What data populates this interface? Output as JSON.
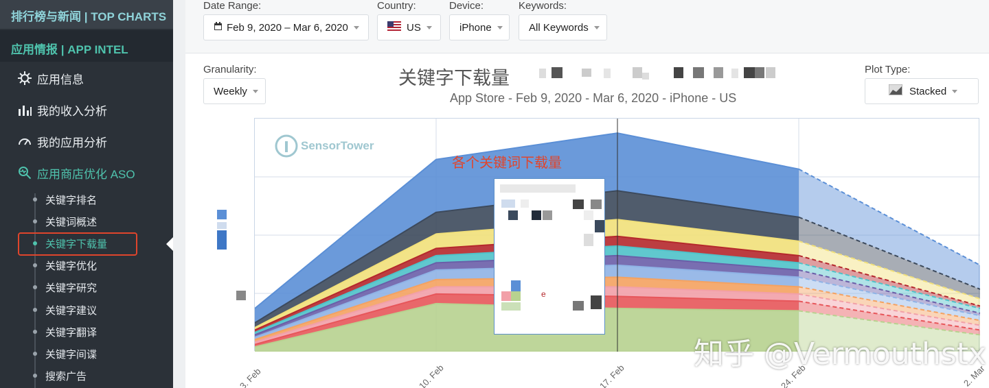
{
  "sidebar": {
    "top_label": "排行榜与新闻 | TOP CHARTS",
    "intel_label": "应用情报 | APP INTEL",
    "items": [
      {
        "label": "应用信息",
        "icon": "app-info-icon"
      },
      {
        "label": "我的收入分析",
        "icon": "revenue-chart-icon"
      },
      {
        "label": "我的应用分析",
        "icon": "gauge-icon"
      },
      {
        "label": "应用商店优化 ASO",
        "icon": "aso-search-icon"
      }
    ],
    "subitems": [
      "关键字排名",
      "关键词概述",
      "关键字下载量",
      "关键字优化",
      "关键字研究",
      "关键字建议",
      "关键字翻译",
      "关键字间谍",
      "搜索广告"
    ]
  },
  "filters": {
    "date_range_label": "Date Range:",
    "date_range_value": "Feb 9, 2020 – Mar 6, 2020",
    "country_label": "Country:",
    "country_value": "US",
    "device_label": "Device:",
    "device_value": "iPhone",
    "keywords_label": "Keywords:",
    "keywords_value": "All Keywords",
    "granularity_label": "Granularity:",
    "granularity_value": "Weekly",
    "plot_type_label": "Plot Type:",
    "plot_type_value": "Stacked"
  },
  "chart_header": {
    "title": "关键字下载量",
    "subtitle": "App Store - Feb 9, 2020 - Mar 6, 2020 - iPhone - US",
    "annotation": "各个关键词下载量",
    "logo_text": "SensorTower"
  },
  "watermark": "知乎 @Vermouthstx",
  "colors": {
    "accent": "#4fc3ad",
    "highlight": "#e0452c",
    "sidebar_bg": "#2b3138"
  },
  "chart_data": {
    "type": "area",
    "stacked": true,
    "categories": [
      "3. Feb",
      "10. Feb",
      "17. Feb",
      "24. Feb",
      "2. Mar"
    ],
    "projected_from_index": 3,
    "series": [
      {
        "color": "#b7d28f",
        "values": [
          2,
          20,
          18,
          17,
          7
        ]
      },
      {
        "color": "#e7565a",
        "values": [
          1,
          4,
          5,
          4,
          2
        ]
      },
      {
        "color": "#f2a0a8",
        "values": [
          1,
          3,
          4,
          3,
          2
        ]
      },
      {
        "color": "#f4a261",
        "values": [
          1,
          3,
          4,
          3,
          2
        ]
      },
      {
        "color": "#8fb3e6",
        "values": [
          1,
          4,
          5,
          4,
          2
        ]
      },
      {
        "color": "#6a5ea8",
        "values": [
          1,
          3,
          4,
          3,
          1
        ]
      },
      {
        "color": "#4fc2c9",
        "values": [
          1,
          3,
          4,
          3,
          2
        ]
      },
      {
        "color": "#b5282c",
        "values": [
          1,
          3,
          4,
          3,
          1
        ]
      },
      {
        "color": "#f1e07a",
        "values": [
          1,
          6,
          7,
          6,
          3
        ]
      },
      {
        "color": "#3d4a5c",
        "values": [
          2,
          9,
          12,
          10,
          4
        ]
      },
      {
        "color": "#5b8fd6",
        "values": [
          6,
          22,
          24,
          20,
          10
        ]
      }
    ],
    "legend": "none",
    "grid": true
  }
}
